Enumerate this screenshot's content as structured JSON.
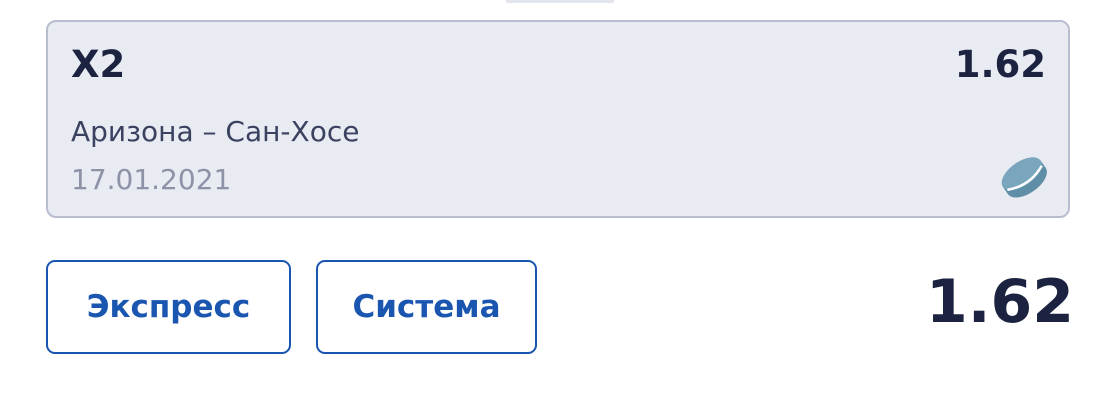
{
  "bet": {
    "outcome": "X2",
    "odds": "1.62",
    "match": "Аризона – Сан-Хосе",
    "date": "17.01.2021",
    "sport_icon": "hockey-puck-icon"
  },
  "actions": {
    "express_label": "Экспресс",
    "system_label": "Система"
  },
  "total": {
    "odds": "1.62"
  },
  "colors": {
    "accent": "#1a56b0",
    "text_dark": "#1b2340",
    "card_bg": "#e9ebf3",
    "card_border": "#b9bdd0",
    "muted": "#8d92a6",
    "icon": "#6b9ab3"
  }
}
